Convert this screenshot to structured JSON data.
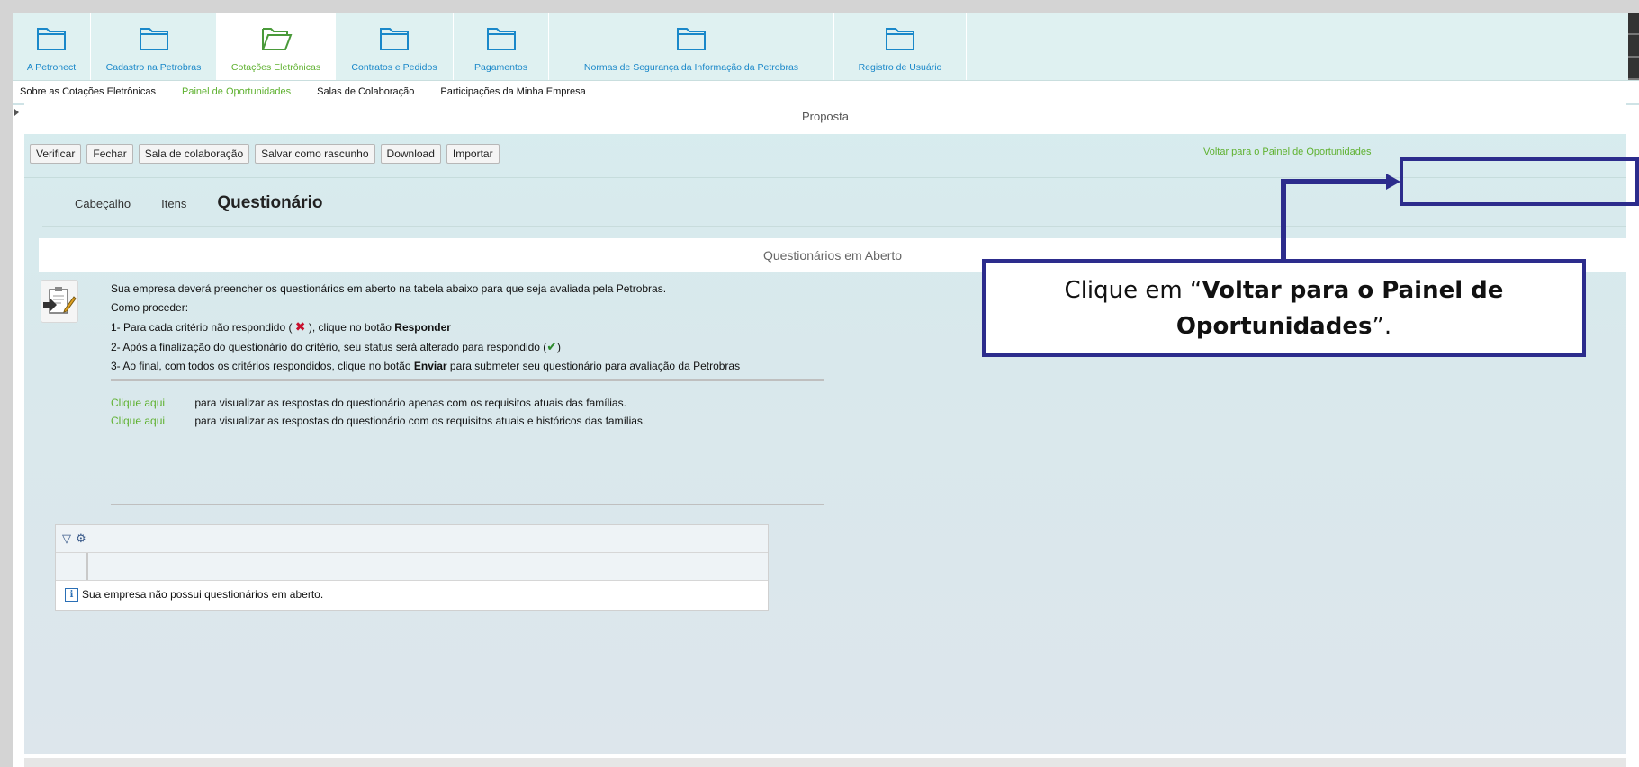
{
  "colors": {
    "accent_green": "#5fb130",
    "nav_blue": "#1a88c9",
    "callout_border": "#2c2c8c",
    "error_red": "#c8102e",
    "ok_green": "#2c8a2c"
  },
  "topnav": {
    "tabs": [
      {
        "label": "A Petronect",
        "icon": "folder-icon"
      },
      {
        "label": "Cadastro na Petrobras",
        "icon": "folder-icon"
      },
      {
        "label": "Cotações Eletrônicas",
        "icon": "folder-open-icon",
        "active": true
      },
      {
        "label": "Contratos e Pedidos",
        "icon": "folder-icon"
      },
      {
        "label": "Pagamentos",
        "icon": "folder-icon"
      },
      {
        "label": "Normas de Segurança da Informação da Petrobras",
        "icon": "folder-icon"
      },
      {
        "label": "Registro de Usuário",
        "icon": "folder-icon"
      }
    ]
  },
  "subnav": {
    "items": [
      {
        "label": "Sobre as Cotações Eletrônicas"
      },
      {
        "label": "Painel de Oportunidades",
        "active": true
      },
      {
        "label": "Salas de Colaboração"
      },
      {
        "label": "Participações da Minha Empresa"
      }
    ]
  },
  "main": {
    "title": "Proposta",
    "toolbar": {
      "verify": "Verificar",
      "close": "Fechar",
      "collab_room": "Sala de colaboração",
      "save_draft": "Salvar como rascunho",
      "download": "Download",
      "import": "Importar"
    },
    "back_link": "Voltar para o Painel de Oportunidades",
    "tabs": {
      "header": "Cabeçalho",
      "items": "Itens",
      "questionnaire": "Questionário"
    },
    "questionnaires_header": "Questionários em Aberto",
    "instructions": {
      "line1": "Sua empresa deverá preencher os questionários em aberto na tabela abaixo para que seja avaliada pela Petrobras.",
      "line2": "Como proceder:",
      "step1_a": "1- Para cada critério não respondido (",
      "step1_mark": "✖",
      "step1_b": "), clique no botão",
      "step1_bold": "Responder",
      "step2_a": "2- Após a finalização do questionário do critério, seu status será alterado para respondido (",
      "step2_mark": "✔",
      "step2_b": ")",
      "step3_a": "3- Ao final, com todos os critérios respondidos, clique no botão",
      "step3_bold": "Enviar",
      "step3_b": "para submeter seu questionário para avaliação da Petrobras"
    },
    "links": [
      {
        "link": "Clique aqui",
        "text": "para visualizar as respostas do questionário apenas com os requisitos atuais das famílias."
      },
      {
        "link": "Clique aqui",
        "text": "para visualizar as respostas do questionário com os requisitos atuais e históricos das famílias."
      }
    ],
    "table": {
      "empty_message": "Sua empresa não possui questionários em aberto."
    }
  },
  "callout": {
    "text_before": "Clique em “",
    "text_bold": "Voltar para o Painel de Oportunidades",
    "text_after": "”."
  }
}
